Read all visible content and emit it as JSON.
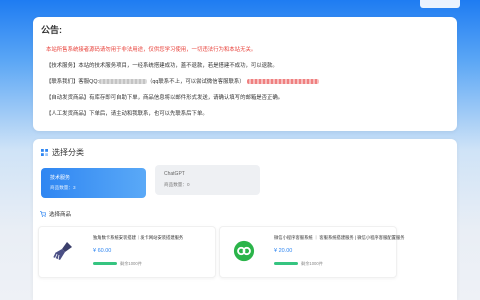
{
  "notice": {
    "title": "公告:",
    "line1": "本站所售系统接者源码请勿用于非法用途，仅供您学习使用，一切违法行为和本站无关。",
    "line2": "【技术服务】本站的技术服务项目，一经系统搭建成功，蓋不退款，若是搭建不成功，可以退款。",
    "line3_prefix": "【联系我们】客服QQ:",
    "line3_mid": "（qq联系不上，可以尝试微信客服联系）",
    "line4": "【自动发货商品】有库存即可自助下单，商品信息将以邮件形式发送，请确认填写的邮箱是否正确。",
    "line5": "【人工发货商品】下单后，请主动和我联系，也可以先联系后下单。"
  },
  "categories": {
    "title": "选择分类",
    "items": [
      {
        "name": "技术服务",
        "count_label": "商品数量：3"
      },
      {
        "name": "ChatGPT",
        "count_label": "商品数量：0"
      }
    ]
  },
  "products": {
    "title": "选择商品",
    "items": [
      {
        "name": "独角数卡系统安装搭建｜发卡网站安装搭建服务",
        "price": "¥ 60.00",
        "stock": "剩余1000件",
        "stock_fill": 1.0,
        "icon": "broom-icon"
      },
      {
        "name": "微信小程序客服系统 ｜ 客服系统搭建服务 | 微信小程序客服配置服务",
        "price": "¥ 20.00",
        "stock": "剩余1000件",
        "stock_fill": 1.0,
        "icon": "wechat-icon"
      }
    ]
  },
  "colors": {
    "accent": "#2f86f2",
    "danger": "#e8413a",
    "stock": "#35c480",
    "wechat": "#2bb44a"
  }
}
